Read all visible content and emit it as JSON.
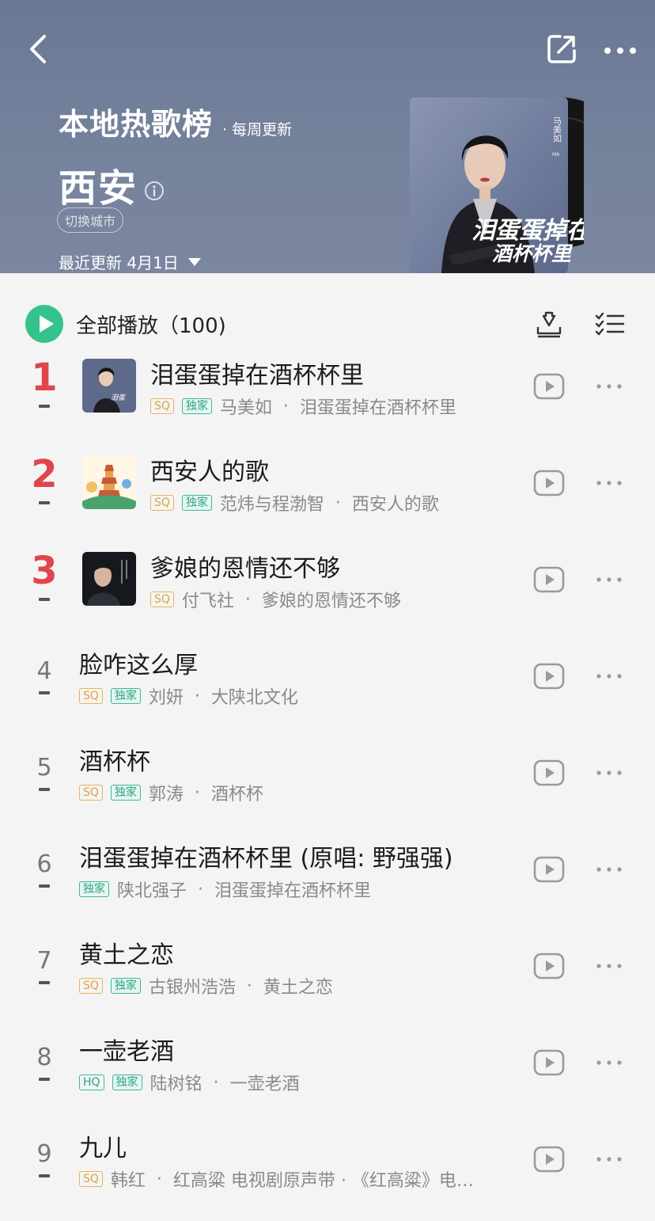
{
  "header": {
    "title": "本地热歌榜",
    "subtitle": "· 每周更新",
    "city": "西安",
    "switch_city": "切换城市",
    "update": "最近更新 4月1日",
    "cover": {
      "artist_vertical": "马美如",
      "artist_latin": "MA",
      "song_art_line1": "泪蛋蛋掉在",
      "song_art_line2": "酒杯杯里"
    }
  },
  "playall": {
    "label": "全部播放（100)"
  },
  "colors": {
    "accent_green": "#34c48b",
    "rank_red": "#e0454b",
    "header_bg": "#72809b"
  },
  "songs": [
    {
      "rank": "1",
      "title": "泪蛋蛋掉在酒杯杯里",
      "badges": [
        "SQ",
        "独家"
      ],
      "artist": "马美如",
      "album": "泪蛋蛋掉在酒杯杯里",
      "has_thumb": true
    },
    {
      "rank": "2",
      "title": "西安人的歌",
      "badges": [
        "SQ",
        "独家"
      ],
      "artist": "范炜与程渤智",
      "album": "西安人的歌",
      "has_thumb": true
    },
    {
      "rank": "3",
      "title": "爹娘的恩情还不够",
      "badges": [
        "SQ"
      ],
      "artist": "付飞社",
      "album": "爹娘的恩情还不够",
      "has_thumb": true
    },
    {
      "rank": "4",
      "title": "脸咋这么厚",
      "badges": [
        "SQ",
        "独家"
      ],
      "artist": "刘妍",
      "album": "大陕北文化"
    },
    {
      "rank": "5",
      "title": "酒杯杯",
      "badges": [
        "SQ",
        "独家"
      ],
      "artist": "郭涛",
      "album": "酒杯杯"
    },
    {
      "rank": "6",
      "title": "泪蛋蛋掉在酒杯杯里 (原唱: 野强强)",
      "badges": [
        "独家"
      ],
      "artist": "陕北强子",
      "album": "泪蛋蛋掉在酒杯杯里"
    },
    {
      "rank": "7",
      "title": "黄土之恋",
      "badges": [
        "SQ",
        "独家"
      ],
      "artist": "古银州浩浩",
      "album": "黄土之恋"
    },
    {
      "rank": "8",
      "title": "一壶老酒",
      "badges": [
        "HQ",
        "独家"
      ],
      "artist": "陆树铭",
      "album": "一壶老酒"
    },
    {
      "rank": "9",
      "title": "九儿",
      "badges": [
        "SQ"
      ],
      "artist": "韩红",
      "album": "红高粱 电视剧原声带 · 《红高粱》电…"
    }
  ]
}
